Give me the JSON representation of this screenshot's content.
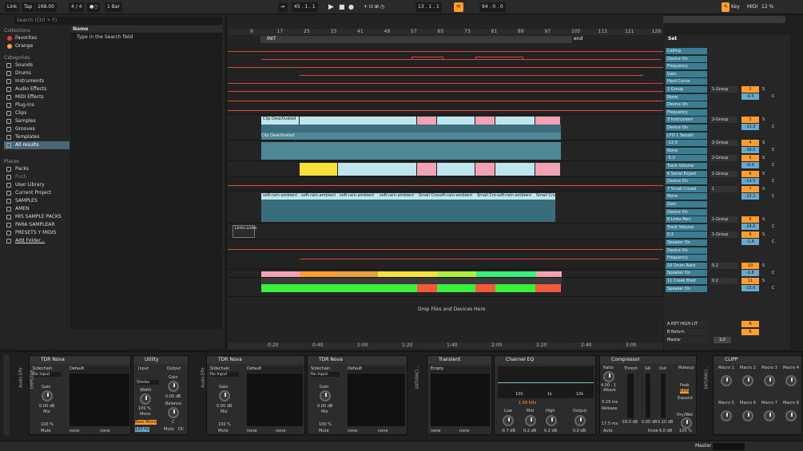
{
  "topbar": {
    "link": "Link",
    "tap": "Tap",
    "tempo": "168.00",
    "sig": "4 / 4",
    "quant": "1 Bar",
    "pos": "45 . 1 . 1",
    "pos2": "13 . 1 . 1",
    "loop_len": "94 . 0 . 0",
    "key": "Key",
    "midi": "MIDI",
    "cpu": "12 %"
  },
  "browser": {
    "search_placeholder": "Search (Ctrl + F)",
    "content_header": "Name",
    "content_hint": "Type in the Search field",
    "collections_title": "Collections",
    "collections": [
      {
        "label": "Favorites",
        "color": "#e24040"
      },
      {
        "label": "Orange",
        "color": "#ff9d2e"
      }
    ],
    "categories_title": "Categories",
    "categories": [
      "Sounds",
      "Drums",
      "Instruments",
      "Audio Effects",
      "MIDI Effects",
      "Plug-Ins",
      "Clips",
      "Samples",
      "Grooves",
      "Templates",
      "All results"
    ],
    "places_title": "Places",
    "places": [
      "Packs",
      "Push",
      "User Library",
      "Current Project",
      "SAMPLES",
      "AMEN",
      "MIS SAMPLE PACKS",
      "PARA SAMPLEAR",
      "PRESETS Y MIDIS",
      "Add Folder..."
    ]
  },
  "arrangement": {
    "ruler": [
      "9",
      "17",
      "25",
      "33",
      "41",
      "49",
      "57",
      "65",
      "73",
      "81",
      "89",
      "97",
      "105",
      "113",
      "121",
      "129"
    ],
    "time_ruler": [
      "0:20",
      "0:40",
      "1:00",
      "1:20",
      "1:40",
      "2:00",
      "2:20",
      "2:40",
      "3:00",
      "3:20"
    ],
    "locator_init": "INIT",
    "locator_end": "end",
    "clip_deactivated": "Clip Deactivated",
    "clip_deactivated2": "Clip Deactivated",
    "rain_clip": "soft-rain-ambient",
    "small_clip": "Small Cro",
    "links_clip": "Links Links",
    "drop_hint": "Drop Files and Devices Here"
  },
  "mixer": {
    "set_label": "Set",
    "rows": [
      {
        "label": "Ceiling",
        "num": "",
        "val": ""
      },
      {
        "label": "Device On",
        "num": "",
        "val": ""
      },
      {
        "label": "Frequency",
        "num": "",
        "val": ""
      },
      {
        "label": "Gain",
        "num": "",
        "val": ""
      },
      {
        "label": "Hard Curve",
        "num": "",
        "val": ""
      },
      {
        "label": "2 Group",
        "num": "2",
        "val": "-0.5",
        "route": "1-Group",
        "extra": "-24.0"
      },
      {
        "label": "None",
        "num": "",
        "val": ""
      },
      {
        "label": "Device On",
        "num": "",
        "val": ""
      },
      {
        "label": "Frequency",
        "num": "",
        "val": ""
      },
      {
        "label": "3 Instrument",
        "num": "3",
        "val": "-11.3",
        "route": "2-Group"
      },
      {
        "label": "Device On",
        "num": "",
        "val": ""
      },
      {
        "label": "LFO 1 Sensiti",
        "num": "",
        "val": ""
      },
      {
        "label": "-12.5",
        "num": "4",
        "val": "-18.0",
        "route": "2-Group"
      },
      {
        "label": "None",
        "num": "",
        "val": ""
      },
      {
        "label": "-5.0",
        "num": "5",
        "val": "-6.0",
        "route": "2-Group"
      },
      {
        "label": "Track Volume",
        "num": "",
        "val": ""
      },
      {
        "label": "6 Serial Experi",
        "num": "6",
        "val": "-13.5",
        "route": "1-Group"
      },
      {
        "label": "Device On",
        "num": "",
        "val": ""
      },
      {
        "label": "7 Small Crowd",
        "num": "7",
        "val": "-15.2",
        "route": "1"
      },
      {
        "label": "None",
        "num": "",
        "val": ""
      },
      {
        "label": "Gain",
        "num": "",
        "val": ""
      },
      {
        "label": "Device On",
        "num": "",
        "val": ""
      },
      {
        "label": "8 Links Perc",
        "num": "8",
        "val": "-24.0",
        "route": "1-Group"
      },
      {
        "label": "Track Volume",
        "num": "",
        "val": ""
      },
      {
        "label": "0.2",
        "num": "9",
        "val": "-1.6",
        "route": "1-Group"
      },
      {
        "label": "Speaker On",
        "num": "",
        "val": ""
      },
      {
        "label": "Device On",
        "num": "",
        "val": ""
      },
      {
        "label": "Frequency",
        "num": "",
        "val": ""
      },
      {
        "label": "10 Drum Rack",
        "num": "10",
        "val": "-0.8",
        "route": "0.2"
      },
      {
        "label": "Speaker On",
        "num": "",
        "val": ""
      },
      {
        "label": "11 Creek Bred",
        "num": "11",
        "val": "-15.6",
        "route": "0.2"
      },
      {
        "label": "Speaker On",
        "num": "",
        "val": ""
      }
    ],
    "returns": [
      {
        "label": "A RET HIGH LIT",
        "num": "A"
      },
      {
        "label": "B Return",
        "num": "B"
      },
      {
        "label": "Master",
        "num": "1/2"
      }
    ],
    "io": {
      "in": "In",
      "auto": "Auto",
      "off": "Off",
      "inf": "-inf",
      "s": "S",
      "c": "C"
    }
  },
  "devices": [
    {
      "name": "TDR Nova",
      "sidechain": "Sidechain",
      "no_input": "No Input",
      "gain": "Gain",
      "gain_val": "0.00 dB",
      "mix": "Mix",
      "mix_val": "100 %",
      "mute": "Mute"
    },
    {
      "name": "Default",
      "none1": "none",
      "none2": "none"
    },
    {
      "name": "Utility",
      "input": "Input",
      "output": "Output",
      "stereo": "Stereo",
      "width": "Width",
      "width_val": "100 %",
      "mono": "Mono",
      "gain": "Gain",
      "gain_val": "0.00 dB",
      "balance": "Balance",
      "balance_val": "C",
      "bass_mono": "Bass Mono",
      "hz": "120 Hz",
      "mute": "Mute",
      "dc": "DC"
    },
    {
      "name": "TDR Nova",
      "sidechain": "Sidechain",
      "no_input": "No Input",
      "gain": "Gain",
      "gain_val": "0.00 dB",
      "mix": "Mix",
      "mix_val": "100 %",
      "mute": "Mute"
    },
    {
      "name": "Default",
      "none1": "none",
      "none2": "none"
    },
    {
      "name": "TDR Nova",
      "sidechain": "Sidechain",
      "no_input": "No Input",
      "gain": "Gain",
      "gain_val": "0.00 dB",
      "mix": "Mix",
      "mix_val": "100 %",
      "mute": "Mute"
    },
    {
      "name": "Default",
      "none1": "none",
      "none2": "none"
    },
    {
      "name": "Transient",
      "empty": "Empty",
      "none1": "none",
      "none2": "none"
    },
    {
      "name": "Channel EQ",
      "freq": "1.50 kHz",
      "low": "Low",
      "low_val": "-0.7 dB",
      "mid": "Mid",
      "mid_val": "0.2 dB",
      "high": "High",
      "high_val": "0.2 dB",
      "output": "Output",
      "out_val": "0.0 dB",
      "ticks": [
        "100",
        "1k",
        "10k"
      ]
    },
    {
      "name": "Compressor",
      "ratio": "Ratio",
      "ratio_val": "4.00 : 1",
      "attack": "Attack",
      "attack_val": "0.29 ms",
      "release": "Release",
      "release_val": "17.5 ms",
      "auto": "Auto",
      "thresh": "Thresh",
      "gr": "GR",
      "out": "Out",
      "makeup": "Makeup",
      "peak": "Peak",
      "rms": "RMS",
      "expand": "Expand",
      "drywet": "Dry/Wet",
      "dw_val": "100 %",
      "knee": "Knee",
      "knee_val": "6.0 dB",
      "tvals": [
        "-18.0 dB",
        "0.00 dB",
        "0.10 dB"
      ]
    },
    {
      "name": "CLIPP",
      "macros": [
        "Macro 1",
        "Macro 2",
        "Macro 3",
        "Macro 4",
        "Macro 5",
        "Macro 6",
        "Macro 7",
        "Macro 8"
      ]
    }
  ],
  "rack_labels": [
    "Audio Effe",
    "EMPEZAR...",
    "Audio Effe",
    "SATURACI...",
    "SATURACI..."
  ],
  "statusbar": {
    "master": "Master"
  }
}
